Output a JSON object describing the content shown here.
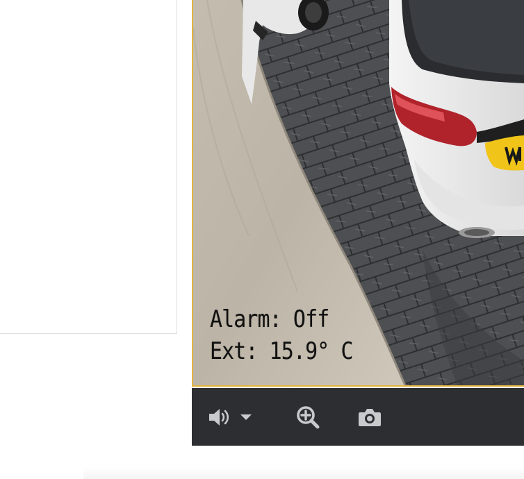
{
  "camera": {
    "osd_alarm": "Alarm: Off",
    "osd_temp": "Ext: 15.9° C",
    "accent_color": "#e2b340"
  },
  "controls": {
    "background_color": "#2d2e32",
    "icon_color": "#c9cacc",
    "items": [
      {
        "icon": "speaker-icon",
        "action": "audio"
      },
      {
        "icon": "caret-down-icon",
        "action": "audio-options"
      },
      {
        "icon": "zoom-in-icon",
        "action": "digital-zoom"
      },
      {
        "icon": "camera-icon",
        "action": "snapshot"
      }
    ]
  }
}
